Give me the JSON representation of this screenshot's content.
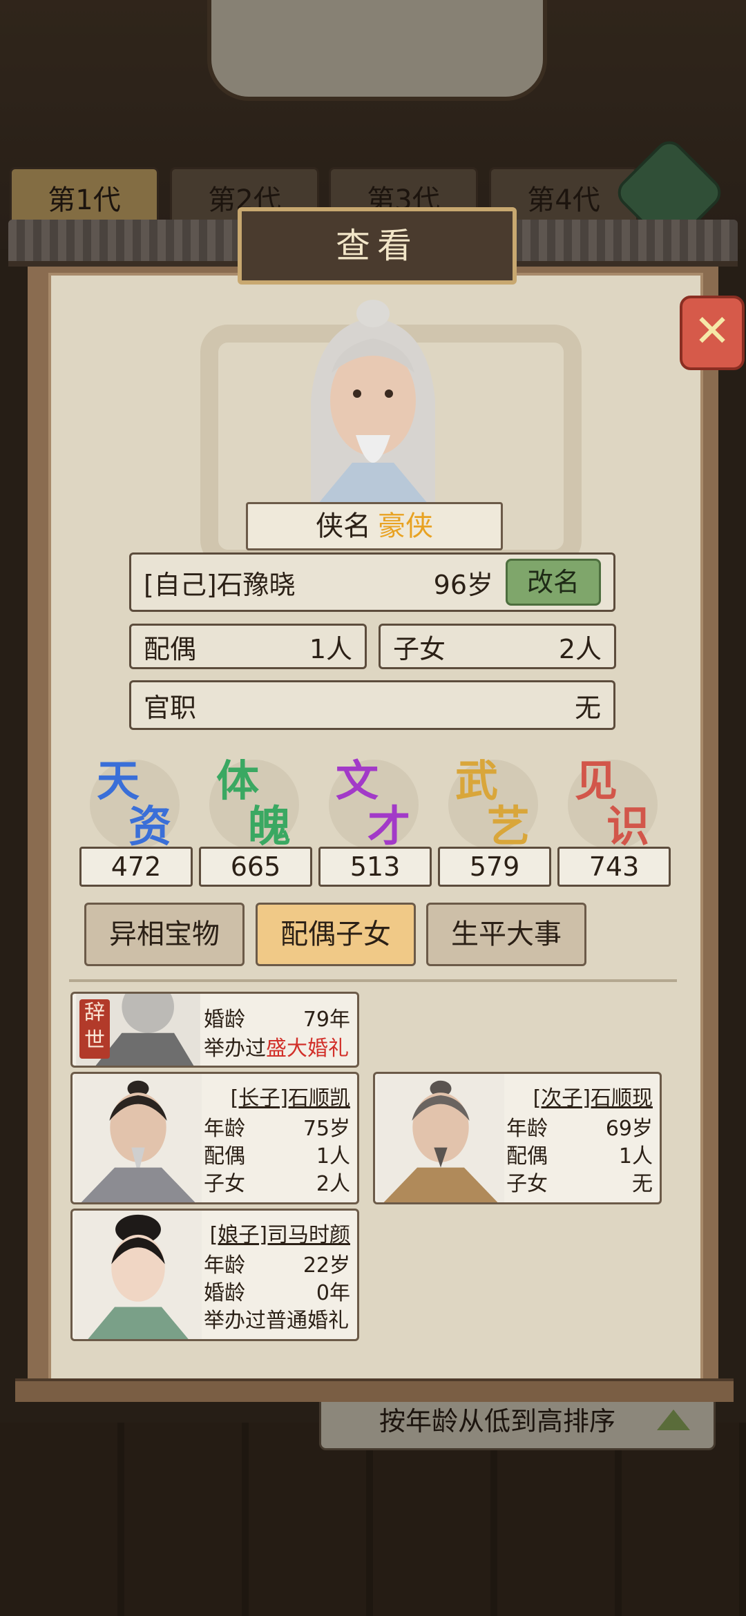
{
  "background": {
    "generation_tabs": [
      "第1代",
      "第2代",
      "第3代",
      "第4代"
    ],
    "sort_label": "按年龄从低到高排序"
  },
  "dialog": {
    "title": "查看",
    "close_label": "✕"
  },
  "character": {
    "title_label": "侠名",
    "title_value": "豪侠",
    "name": "[自己]石豫晓",
    "age": "96岁",
    "rename_label": "改名",
    "spouse_label": "配偶",
    "spouse_value": "1人",
    "children_label": "子女",
    "children_value": "2人",
    "office_label": "官职",
    "office_value": "无"
  },
  "stats": [
    {
      "c1": "天",
      "c2": "资",
      "value": "472",
      "color": "#3a6fd8"
    },
    {
      "c1": "体",
      "c2": "魄",
      "value": "665",
      "color": "#3aa862"
    },
    {
      "c1": "文",
      "c2": "才",
      "value": "513",
      "color": "#a23ac8"
    },
    {
      "c1": "武",
      "c2": "艺",
      "value": "579",
      "color": "#d9a63a"
    },
    {
      "c1": "见",
      "c2": "识",
      "value": "743",
      "color": "#d2564a"
    }
  ],
  "tabs": [
    "异相宝物",
    "配偶子女",
    "生平大事"
  ],
  "family": {
    "deceased_badge": "辞世",
    "deceased_wife": {
      "marriage_age_label": "婚龄",
      "marriage_age_value": "79年",
      "wedding_prefix": "举办过",
      "wedding_type": "盛大婚礼"
    },
    "eldest_son": {
      "name": "[长子]石顺凯",
      "age_label": "年龄",
      "age_value": "75岁",
      "spouse_label": "配偶",
      "spouse_value": "1人",
      "children_label": "子女",
      "children_value": "2人"
    },
    "second_son": {
      "name": "[次子]石顺现",
      "age_label": "年龄",
      "age_value": "69岁",
      "spouse_label": "配偶",
      "spouse_value": "1人",
      "children_label": "子女",
      "children_value": "无"
    },
    "concubine": {
      "name": "[娘子]司马时颜",
      "age_label": "年龄",
      "age_value": "22岁",
      "marriage_age_label": "婚龄",
      "marriage_age_value": "0年",
      "wedding_text": "举办过普通婚礼"
    }
  }
}
